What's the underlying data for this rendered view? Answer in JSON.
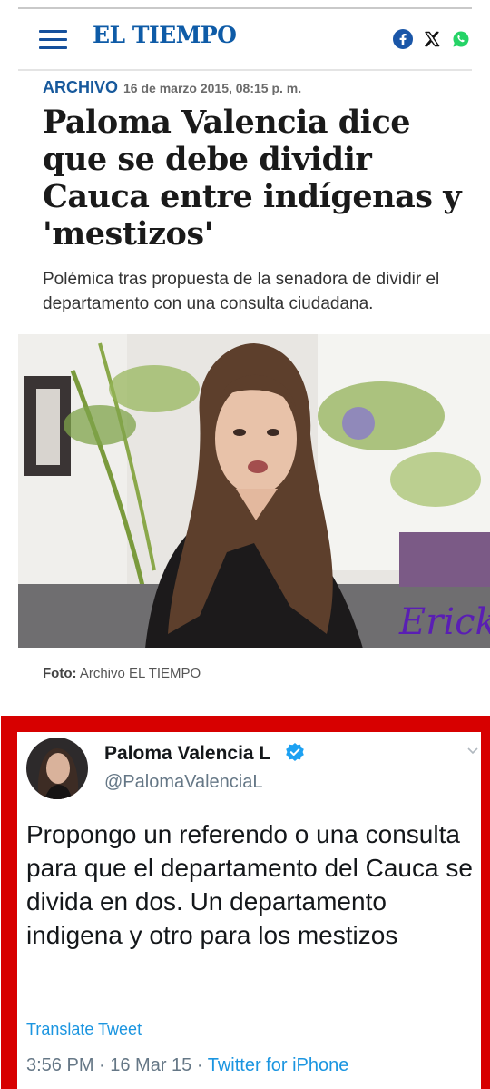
{
  "header": {
    "logo": "EL TIEMPO",
    "menu_icon": "hamburger-menu-icon",
    "share": [
      "facebook-icon",
      "x-icon",
      "whatsapp-icon"
    ],
    "colors": {
      "brand": "#0e5ba7",
      "facebook": "#1a56a8",
      "whatsapp": "#25d366"
    }
  },
  "article": {
    "section": "ARCHIVO",
    "date": "16 de marzo 2015, 08:15 p. m.",
    "headline": "Paloma Valencia dice que se debe dividir Cauca entre indígenas y 'mestizos'",
    "subhead": "Polémica tras propuesta de la senadora de dividir el departamento con una consulta ciudadana.",
    "photo_overlay": "Erick",
    "caption_label": "Foto:",
    "caption_text": "Archivo EL TIEMPO"
  },
  "tweet": {
    "name": "Paloma Valencia L",
    "verified_icon": "verified-badge-icon",
    "handle": "@PalomaValenciaL",
    "text": "Propongo un referendo o una consulta para que el departamento del Cauca se divida en dos. Un departamento indigena y otro para los mestizos",
    "translate": "Translate Tweet",
    "time": "3:56 PM · 16 Mar 15 · ",
    "source": "Twitter for iPhone",
    "colors": {
      "frame": "#d70000",
      "link": "#1b95e0"
    }
  }
}
